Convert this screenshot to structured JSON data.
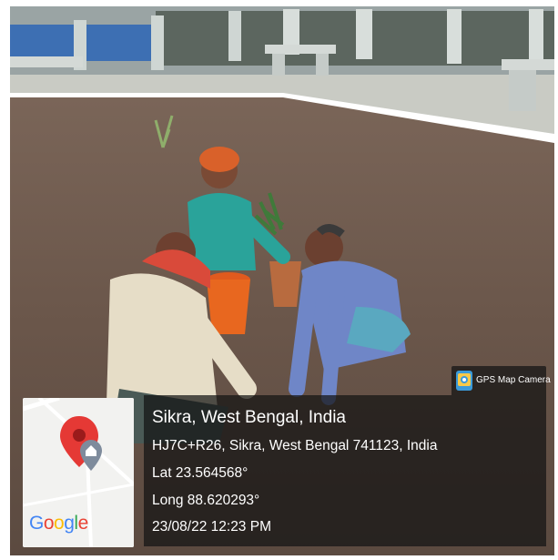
{
  "badge": {
    "label": "GPS Map Camera",
    "icon": "camera-icon"
  },
  "map": {
    "brand": "Google",
    "pin_color": "#e53935",
    "pin_icon": "map-pin-icon",
    "secondary_icon": "location-home-icon"
  },
  "location": {
    "place": "Sikra, West Bengal, India",
    "address": "HJ7C+R26, Sikra, West Bengal 741123, India",
    "lat": "Lat 23.564568°",
    "long": "Long 88.620293°",
    "datetime": "23/08/22 12:23 PM"
  },
  "google_colors": [
    "#4285F4",
    "#EA4335",
    "#FBBC05",
    "#4285F4",
    "#34A853",
    "#EA4335"
  ]
}
